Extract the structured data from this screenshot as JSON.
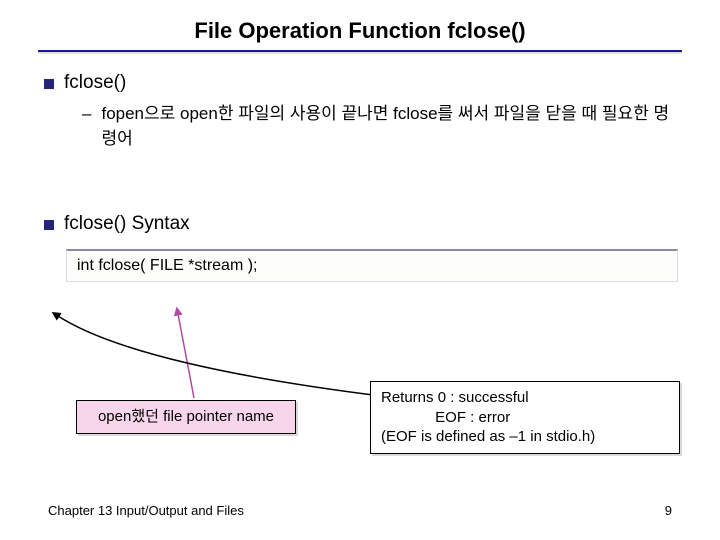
{
  "title": "File Operation Function fclose()",
  "sections": {
    "a": {
      "head": "fclose()",
      "sub": "fopen으로 open한 파일의 사용이 끝나면 fclose를 써서 파일을 닫을 때 필요한 명령어"
    },
    "b": {
      "head": "fclose() Syntax"
    }
  },
  "code": "int fclose( FILE *stream );",
  "pink": "open했던 file pointer name",
  "white_l1": "Returns  0     : successful",
  "white_l2": "             EOF : error",
  "white_l3": "(EOF is defined as –1 in stdio.h)",
  "footer": {
    "chapter": "Chapter 13   Input/Output and Files",
    "page": "9"
  }
}
